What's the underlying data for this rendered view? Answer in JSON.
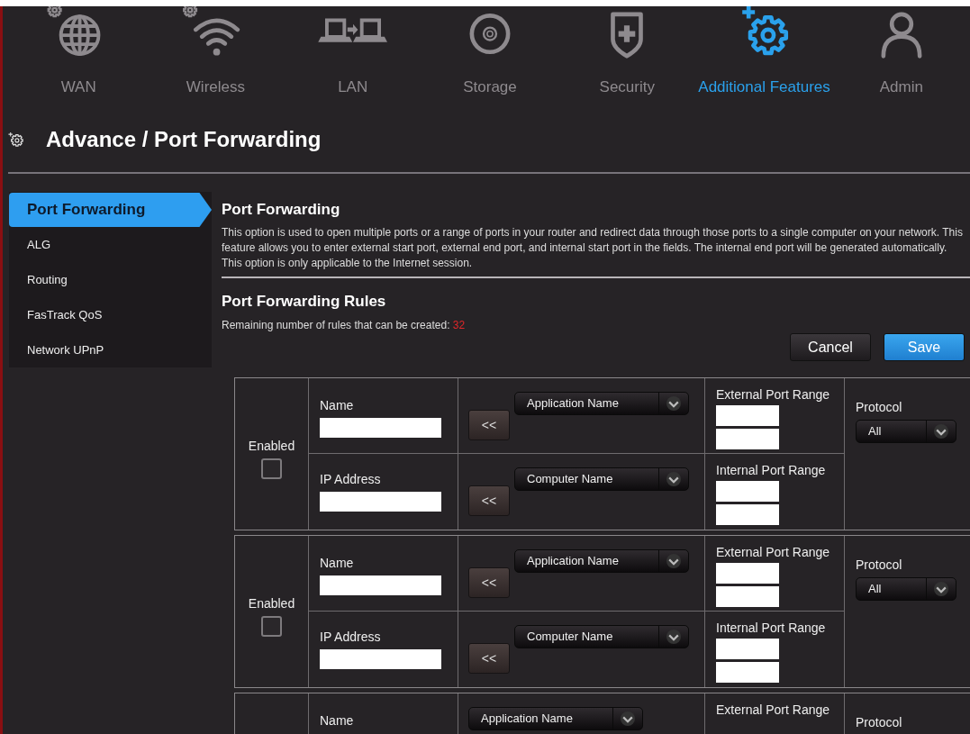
{
  "nav": [
    {
      "label": "WAN",
      "selected": false
    },
    {
      "label": "Wireless",
      "selected": false
    },
    {
      "label": "LAN",
      "selected": false
    },
    {
      "label": "Storage",
      "selected": false
    },
    {
      "label": "Security",
      "selected": false
    },
    {
      "label": "Additional Features",
      "selected": true
    },
    {
      "label": "Admin",
      "selected": false
    }
  ],
  "page_title": "Advance / Port Forwarding",
  "sidebar": [
    {
      "label": "Port Forwarding",
      "selected": true
    },
    {
      "label": "ALG",
      "selected": false
    },
    {
      "label": "Routing",
      "selected": false
    },
    {
      "label": "FasTrack QoS",
      "selected": false
    },
    {
      "label": "Network UPnP",
      "selected": false
    }
  ],
  "section": {
    "title": "Port Forwarding",
    "description": "This option is used to open multiple ports or a range of ports in your router and redirect data through those ports to a single computer on your network. This feature allows you to enter external start port, external end port, and internal start port in the fields. The internal end port will be generated automatically. This option is only applicable to the Internet session."
  },
  "rules_section": {
    "title": "Port Forwarding Rules",
    "remaining_label": "Remaining number of rules that can be created:",
    "remaining_count": "32"
  },
  "buttons": {
    "cancel": "Cancel",
    "save": "Save"
  },
  "rules": [
    {
      "enabled_label": "Enabled",
      "enabled": false,
      "name_label": "Name",
      "app_button": "<<",
      "app_select": "Application Name",
      "ext_label": "External Port Range",
      "protocol_label": "Protocol",
      "protocol_value": "All",
      "ip_label": "IP Address",
      "comp_button": "<<",
      "comp_select": "Computer Name",
      "int_label": "Internal Port Range"
    },
    {
      "enabled_label": "Enabled",
      "enabled": false,
      "name_label": "Name",
      "app_button": "<<",
      "app_select": "Application Name",
      "ext_label": "External Port Range",
      "protocol_label": "Protocol",
      "protocol_value": "All",
      "ip_label": "IP Address",
      "comp_button": "<<",
      "comp_select": "Computer Name",
      "int_label": "Internal Port Range"
    },
    {
      "name_label": "Name",
      "app_select": "Application Name",
      "ext_label": "External Port Range",
      "protocol_label": "Protocol"
    }
  ]
}
